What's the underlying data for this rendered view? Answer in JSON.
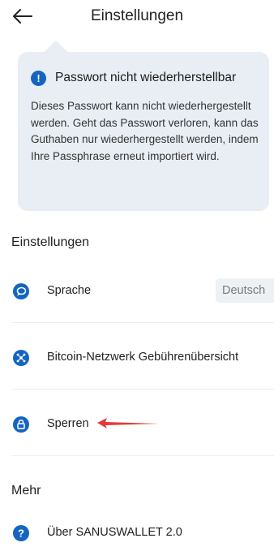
{
  "header": {
    "title": "Einstellungen"
  },
  "notice": {
    "title": "Passwort nicht wiederherstellbar",
    "body": "Dieses Passwort kann nicht wiederhergestellt werden. Geht das Passwort verloren, kann das Guthaben nur wiederhergestellt werden, indem Ihre Passphrase erneut importiert wird."
  },
  "sections": {
    "settings_title": "Einstellungen",
    "more_title": "Mehr"
  },
  "items": {
    "language": {
      "label": "Sprache",
      "value": "Deutsch",
      "icon": "chat-bubble-icon"
    },
    "fees": {
      "label": "Bitcoin-Netzwerk Gebührenübersicht",
      "icon": "network-icon"
    },
    "lock": {
      "label": "Sperren",
      "icon": "lock-icon"
    },
    "about": {
      "label": "Über SANUSWALLET 2.0",
      "icon": "question-icon"
    }
  },
  "colors": {
    "accent": "#1565c0",
    "callout_bg": "#e9eef5",
    "annotation_arrow": "#e53935"
  }
}
